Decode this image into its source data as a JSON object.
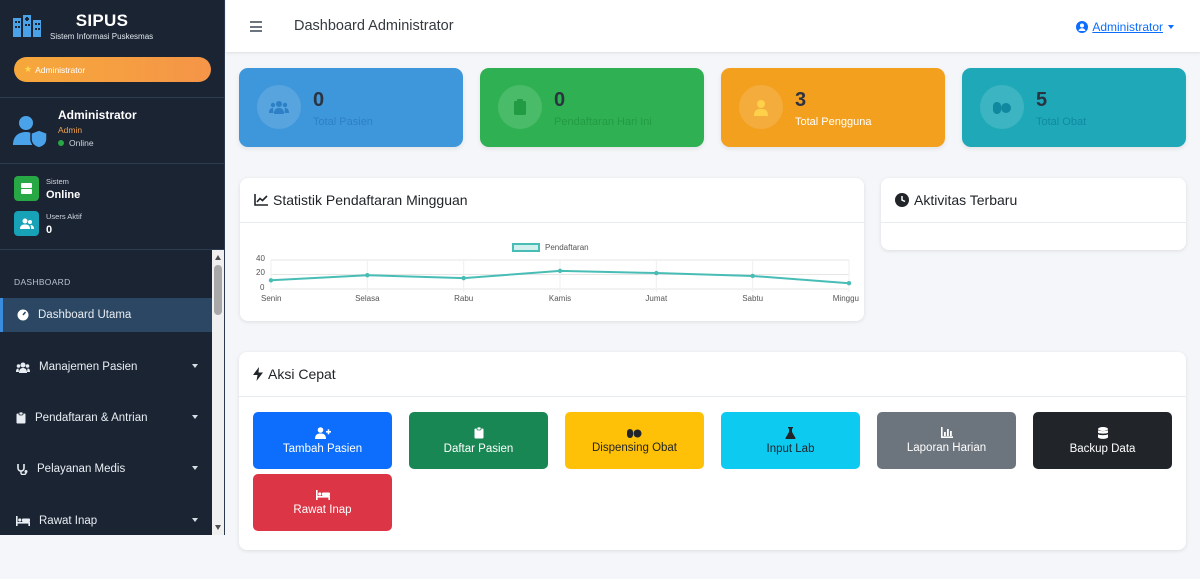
{
  "app": {
    "name": "SIPUS",
    "subtitle": "Sistem Informasi Puskesmas",
    "role_pill": "Administrator"
  },
  "user": {
    "name": "Administrator",
    "role": "Admin",
    "status": "Online"
  },
  "sidebar_stats": [
    {
      "label": "Sistem",
      "value": "Online",
      "color": "#28a745",
      "icon": "server-icon"
    },
    {
      "label": "Users Aktif",
      "value": "0",
      "color": "#17a2b8",
      "icon": "users-icon"
    }
  ],
  "nav": {
    "heading": "DASHBOARD",
    "items": [
      {
        "label": "Dashboard Utama",
        "icon": "tachometer-icon",
        "active": true
      },
      {
        "label": "Manajemen Pasien",
        "icon": "users-icon"
      },
      {
        "label": "Pendaftaran & Antrian",
        "icon": "clipboard-icon"
      },
      {
        "label": "Pelayanan Medis",
        "icon": "stethoscope-icon"
      },
      {
        "label": "Rawat Inap",
        "icon": "bed-icon"
      }
    ]
  },
  "topbar": {
    "title": "Dashboard Administrator",
    "user_menu": "Administrator"
  },
  "info_boxes": [
    {
      "value": "0",
      "label": "Total Pasien",
      "color": "#3f97db",
      "icon": "users-icon"
    },
    {
      "value": "0",
      "label": "Pendaftaran Hari Ini",
      "color": "#2fb153",
      "icon": "clipboard-icon"
    },
    {
      "value": "3",
      "label": "Total Pengguna",
      "color": "#f3a01f",
      "icon": "user-doctor-icon"
    },
    {
      "value": "5",
      "label": "Total Obat",
      "color": "#1fa9b8",
      "icon": "pills-icon"
    }
  ],
  "weekly_card": {
    "title": "Statistik Pendaftaran Mingguan"
  },
  "activity_card": {
    "title": "Aktivitas Terbaru"
  },
  "chart_data": {
    "type": "line",
    "categories": [
      "Senin",
      "Selasa",
      "Rabu",
      "Kamis",
      "Jumat",
      "Sabtu",
      "Minggu"
    ],
    "series": [
      {
        "name": "Pendaftaran",
        "values": [
          12,
          19,
          15,
          25,
          22,
          18,
          8
        ]
      }
    ],
    "yticks": [
      "40",
      "20",
      "0"
    ],
    "ylim": [
      0,
      40
    ],
    "legend_position": "top",
    "grid": true,
    "color": "#48bdb6"
  },
  "quick_actions": {
    "title": "Aksi Cepat",
    "buttons": [
      {
        "label": "Tambah Pasien",
        "color": "#0d6efd",
        "icon": "user-plus-icon"
      },
      {
        "label": "Daftar Pasien",
        "color": "#198754",
        "icon": "clipboard-icon"
      },
      {
        "label": "Dispensing Obat",
        "color": "#ffc107",
        "icon": "pills-icon"
      },
      {
        "label": "Input Lab",
        "color": "#0dcaf0",
        "icon": "flask-icon"
      },
      {
        "label": "Laporan Harian",
        "color": "#6c757d",
        "icon": "chart-icon"
      },
      {
        "label": "Backup Data",
        "color": "#212529",
        "icon": "database-icon"
      },
      {
        "label": "Rawat Inap",
        "color": "#dc3545",
        "icon": "bed-icon"
      }
    ]
  }
}
